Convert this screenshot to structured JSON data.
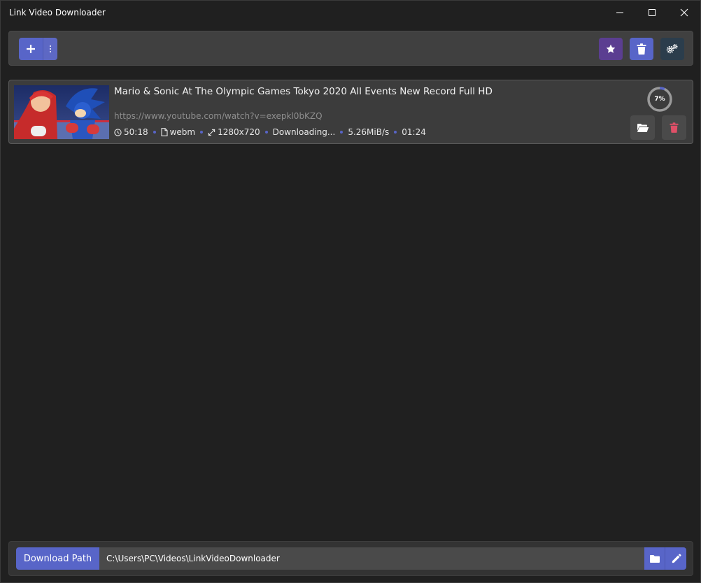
{
  "window": {
    "title": "Link Video Downloader",
    "controls": {
      "minimize": "minimize-icon",
      "maximize": "maximize-icon",
      "close": "close-icon"
    }
  },
  "toolbar": {
    "add_icon": "plus-icon",
    "more_icon": "vertical-dots-icon",
    "favorites_icon": "star-icon",
    "clear_icon": "trash-icon",
    "settings_icon": "gears-icon"
  },
  "downloads": [
    {
      "title": "Mario & Sonic At The Olympic Games Tokyo 2020 All Events New Record Full HD",
      "url": "https://www.youtube.com/watch?v=exepkl0bKZQ",
      "duration": "50:18",
      "format": "webm",
      "resolution": "1280x720",
      "status": "Downloading...",
      "speed": "5.26MiB/s",
      "eta": "01:24",
      "progress_label": "7%",
      "progress": 0.07
    }
  ],
  "footer": {
    "path_label": "Download Path",
    "path_value": "C:\\Users\\PC\\Videos\\LinkVideoDownloader"
  },
  "colors": {
    "accent": "#5865c8",
    "favorite": "#5b3e91",
    "settings": "#2b3d4c",
    "danger": "#e05068",
    "background": "#202020"
  }
}
